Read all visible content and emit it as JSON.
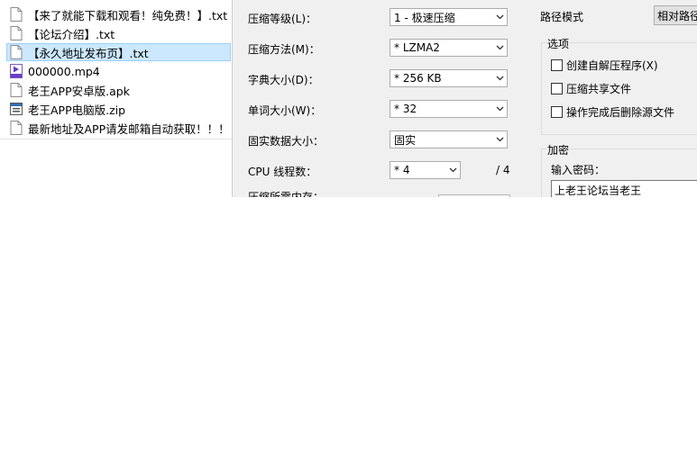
{
  "file_list": [
    {
      "name": "【来了就能下载和观看！纯免费！】.txt",
      "icon": "text-file-icon",
      "selected": false
    },
    {
      "name": "【论坛介绍】.txt",
      "icon": "text-file-icon",
      "selected": false
    },
    {
      "name": "【永久地址发布页】.txt",
      "icon": "text-file-icon",
      "selected": true
    },
    {
      "name": "000000.mp4",
      "icon": "video-file-icon",
      "selected": false
    },
    {
      "name": "老王APP安卓版.apk",
      "icon": "text-file-icon",
      "selected": false
    },
    {
      "name": "老王APP电脑版.zip",
      "icon": "zip-file-icon",
      "selected": false
    },
    {
      "name": "最新地址及APP请发邮箱自动获取！！！....",
      "icon": "text-file-icon",
      "selected": false
    }
  ],
  "settings": {
    "level_label": "压缩等级(L)：",
    "level_value": "1 - 极速压缩",
    "method_label": "压缩方法(M)：",
    "method_value": "* LZMA2",
    "dict_label": "字典大小(D)：",
    "dict_value": "* 256 KB",
    "word_label": "单词大小(W)：",
    "word_value": "* 32",
    "solid_label": "固实数据大小：",
    "solid_value": "固实",
    "cpu_label": "CPU 线程数：",
    "cpu_value": "* 4",
    "cpu_total": "/ 4",
    "mem_label": "压缩所需内存："
  },
  "path_mode": {
    "label": "路径模式",
    "value": "相对路径"
  },
  "options": {
    "title": "选项",
    "sfx": "创建自解压程序(X)",
    "shared": "压缩共享文件",
    "delete_after": "操作完成后删除源文件"
  },
  "encryption": {
    "title": "加密",
    "password_label": "输入密码：",
    "password_value": "上老王论坛当老王"
  }
}
